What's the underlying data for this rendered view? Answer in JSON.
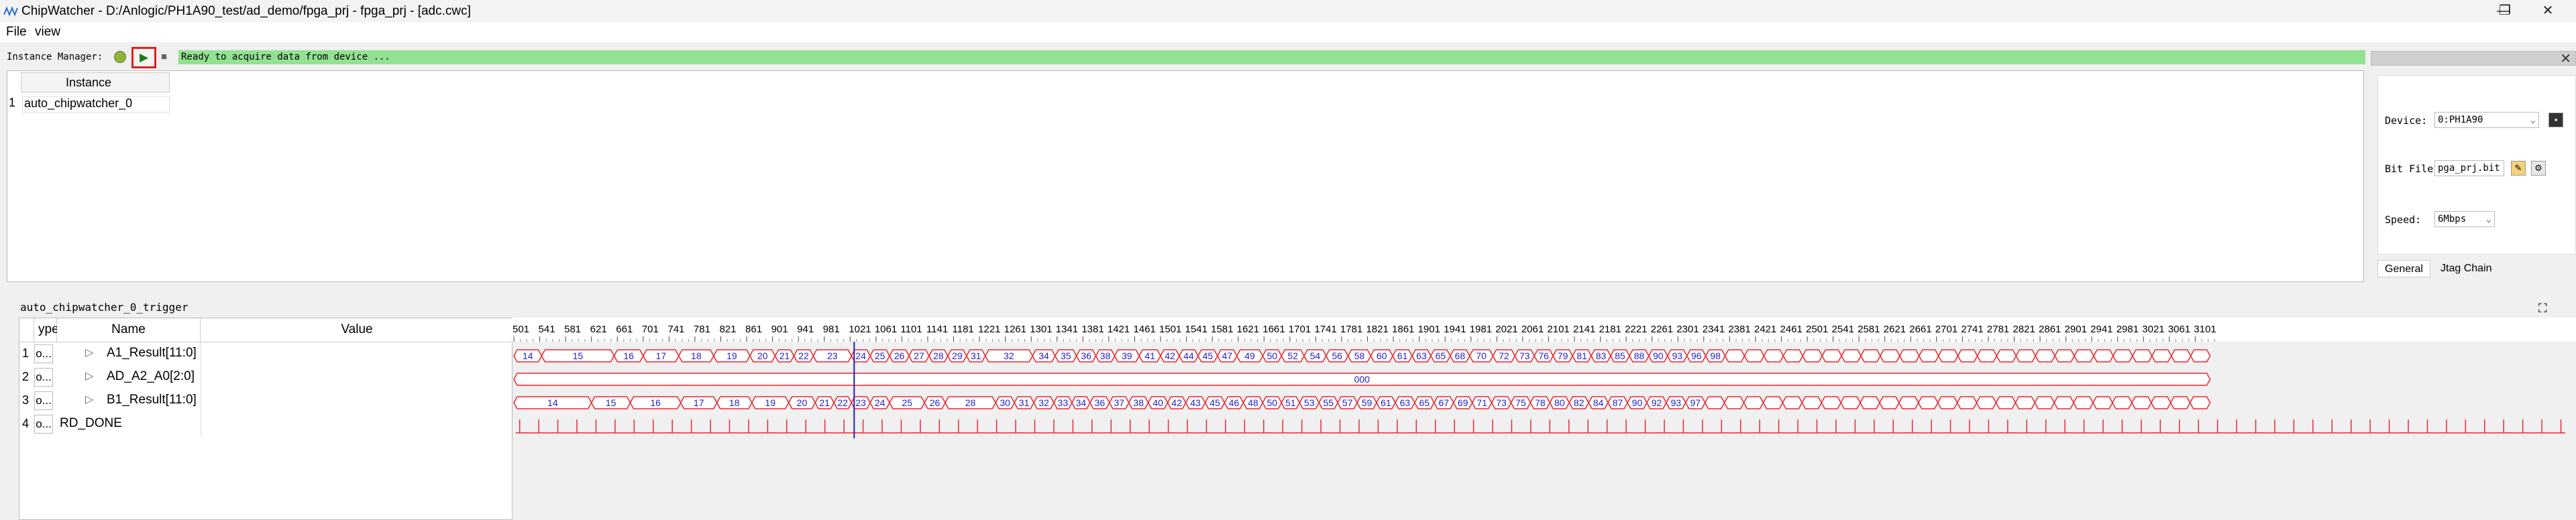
{
  "window": {
    "title": "ChipWatcher - D:/Anlogic/PH1A90_test/ad_demo/fpga_prj - fpga_prj - [adc.cwc]",
    "minimize": "—",
    "maximize": "❐",
    "close": "✕"
  },
  "menu": {
    "file": "File",
    "view": "view"
  },
  "toolbar": {
    "instance_manager_label": "Instance Manager:",
    "play_glyph": "▶",
    "stop_glyph": "■",
    "status_text": "Ready to acquire data from device ..."
  },
  "instances": {
    "header": "Instance",
    "rows": [
      {
        "num": "1",
        "name": "auto_chipwatcher_0"
      }
    ]
  },
  "jtag_panel": {
    "close": "✕",
    "device_label": "Device:",
    "device_value": "0:PH1A90",
    "bitfile_label": "Bit File:",
    "bitfile_value": "pga_prj.bit",
    "speed_label": "Speed:",
    "speed_value": "6Mbps",
    "tabs": [
      "General",
      "Jtag Chain"
    ]
  },
  "trigger": {
    "title": "auto_chipwatcher_0_trigger",
    "columns": {
      "type": "ype",
      "name": "Name",
      "value": "Value"
    },
    "signals": [
      {
        "num": "1",
        "type": "o...",
        "expand": "▷",
        "name": "A1_Result[11:0]"
      },
      {
        "num": "2",
        "type": "o...",
        "expand": "▷",
        "name": "AD_A2_A0[2:0]"
      },
      {
        "num": "3",
        "type": "o...",
        "expand": "▷",
        "name": "B1_Result[11:0]"
      },
      {
        "num": "4",
        "type": "o...",
        "expand": "",
        "name": "RD_DONE"
      }
    ]
  },
  "colors": {
    "wave": "#e8282e",
    "wave_text": "#2222cc",
    "cursor": "#2020c0",
    "status_bg": "#92e292"
  },
  "chart_data": {
    "type": "waveform",
    "ticks": [
      "501",
      "541",
      "581",
      "621",
      "661",
      "701",
      "741",
      "781",
      "821",
      "861",
      "901",
      "941",
      "981",
      "1021",
      "1061",
      "1101",
      "1141",
      "1181",
      "1221",
      "1261",
      "1301",
      "1341",
      "1381",
      "1421",
      "1461",
      "1501",
      "1541",
      "1581",
      "1621",
      "1661",
      "1701",
      "1741",
      "1781",
      "1821",
      "1861",
      "1901",
      "1941",
      "1981",
      "2021",
      "2061",
      "2101",
      "2141",
      "2181",
      "2221",
      "2261",
      "2301",
      "2341",
      "2381",
      "2421",
      "2461",
      "2501",
      "2541",
      "2581",
      "2621",
      "2661",
      "2701",
      "2741",
      "2781",
      "2821",
      "2861",
      "2901",
      "2941",
      "2981",
      "3021",
      "3061",
      "3101"
    ],
    "cursor_at": 1021,
    "buses": [
      {
        "name": "A1_Result[11:0]",
        "segments": [
          [
            501,
            544,
            "14"
          ],
          [
            544,
            656,
            "15"
          ],
          [
            656,
            701,
            "16"
          ],
          [
            701,
            756,
            "17"
          ],
          [
            756,
            810,
            "18"
          ],
          [
            810,
            866,
            "19"
          ],
          [
            866,
            905,
            "20"
          ],
          [
            905,
            934,
            "21"
          ],
          [
            934,
            964,
            "22"
          ],
          [
            964,
            1023,
            "23"
          ],
          [
            1023,
            1052,
            "24"
          ],
          [
            1052,
            1082,
            "25"
          ],
          [
            1082,
            1112,
            "26"
          ],
          [
            1112,
            1143,
            "27"
          ],
          [
            1143,
            1172,
            "28"
          ],
          [
            1172,
            1201,
            "29"
          ],
          [
            1201,
            1230,
            "31"
          ],
          [
            1230,
            1303,
            "32"
          ],
          [
            1303,
            1338,
            "34"
          ],
          [
            1338,
            1371,
            "35"
          ],
          [
            1371,
            1401,
            "36"
          ],
          [
            1401,
            1430,
            "38"
          ],
          [
            1430,
            1468,
            "39"
          ],
          [
            1468,
            1501,
            "41"
          ],
          [
            1501,
            1530,
            "42"
          ],
          [
            1530,
            1559,
            "44"
          ],
          [
            1559,
            1589,
            "45"
          ],
          [
            1589,
            1619,
            "47"
          ],
          [
            1619,
            1659,
            "49"
          ],
          [
            1659,
            1688,
            "50"
          ],
          [
            1688,
            1723,
            "52"
          ],
          [
            1723,
            1757,
            "54"
          ],
          [
            1757,
            1791,
            "56"
          ],
          [
            1791,
            1826,
            "58"
          ],
          [
            1826,
            1860,
            "60"
          ],
          [
            1860,
            1890,
            "61"
          ],
          [
            1890,
            1919,
            "63"
          ],
          [
            1919,
            1949,
            "65"
          ],
          [
            1949,
            1979,
            "68"
          ],
          [
            1979,
            2015,
            "70"
          ],
          [
            2015,
            2049,
            "72"
          ],
          [
            2049,
            2079,
            "73"
          ],
          [
            2079,
            2108,
            "76"
          ],
          [
            2108,
            2138,
            "79"
          ],
          [
            2138,
            2167,
            "81"
          ],
          [
            2167,
            2197,
            "83"
          ],
          [
            2197,
            2226,
            "85"
          ],
          [
            2226,
            2256,
            "88"
          ],
          [
            2256,
            2285,
            "90"
          ],
          [
            2285,
            2315,
            "93"
          ],
          [
            2315,
            2344,
            "96"
          ],
          [
            2344,
            2374,
            "98"
          ],
          [
            2374,
            2404,
            ""
          ],
          [
            2404,
            2434,
            ""
          ],
          [
            2434,
            2464,
            ""
          ],
          [
            2464,
            2494,
            ""
          ],
          [
            2494,
            2524,
            ""
          ],
          [
            2524,
            2554,
            ""
          ],
          [
            2554,
            2584,
            ""
          ],
          [
            2584,
            2614,
            ""
          ],
          [
            2614,
            2644,
            ""
          ],
          [
            2644,
            2674,
            ""
          ],
          [
            2674,
            2704,
            ""
          ],
          [
            2704,
            2734,
            ""
          ],
          [
            2734,
            2764,
            ""
          ],
          [
            2764,
            2794,
            ""
          ],
          [
            2794,
            2824,
            ""
          ],
          [
            2824,
            2854,
            ""
          ],
          [
            2854,
            2884,
            ""
          ],
          [
            2884,
            2914,
            ""
          ],
          [
            2914,
            2944,
            ""
          ],
          [
            2944,
            2974,
            ""
          ],
          [
            2974,
            3004,
            ""
          ],
          [
            3004,
            3034,
            ""
          ],
          [
            3034,
            3064,
            ""
          ],
          [
            3064,
            3094,
            ""
          ],
          [
            3094,
            3124,
            ""
          ]
        ]
      },
      {
        "name": "AD_A2_A0[2:0]",
        "segments": [
          [
            501,
            3124,
            "000"
          ]
        ]
      },
      {
        "name": "B1_Result[11:0]",
        "segments": [
          [
            501,
            621,
            "14"
          ],
          [
            621,
            681,
            "15"
          ],
          [
            681,
            759,
            "16"
          ],
          [
            759,
            815,
            "17"
          ],
          [
            815,
            869,
            "18"
          ],
          [
            869,
            926,
            "19"
          ],
          [
            926,
            967,
            "20"
          ],
          [
            967,
            996,
            "21"
          ],
          [
            996,
            1023,
            "22"
          ],
          [
            1023,
            1052,
            "23"
          ],
          [
            1052,
            1082,
            "24"
          ],
          [
            1082,
            1136,
            "25"
          ],
          [
            1136,
            1168,
            "26"
          ],
          [
            1168,
            1246,
            "28"
          ],
          [
            1246,
            1275,
            "30"
          ],
          [
            1275,
            1305,
            "31"
          ],
          [
            1305,
            1336,
            "32"
          ],
          [
            1336,
            1364,
            "33"
          ],
          [
            1364,
            1392,
            "34"
          ],
          [
            1392,
            1422,
            "36"
          ],
          [
            1422,
            1452,
            "37"
          ],
          [
            1452,
            1482,
            "38"
          ],
          [
            1482,
            1512,
            "40"
          ],
          [
            1512,
            1540,
            "42"
          ],
          [
            1540,
            1570,
            "43"
          ],
          [
            1570,
            1600,
            "45"
          ],
          [
            1600,
            1629,
            "46"
          ],
          [
            1629,
            1659,
            "48"
          ],
          [
            1659,
            1688,
            "50"
          ],
          [
            1688,
            1716,
            "51"
          ],
          [
            1716,
            1746,
            "53"
          ],
          [
            1746,
            1775,
            "55"
          ],
          [
            1775,
            1805,
            "57"
          ],
          [
            1805,
            1835,
            "59"
          ],
          [
            1835,
            1864,
            "61"
          ],
          [
            1864,
            1894,
            "63"
          ],
          [
            1894,
            1924,
            "65"
          ],
          [
            1924,
            1954,
            "67"
          ],
          [
            1954,
            1983,
            "69"
          ],
          [
            1983,
            2013,
            "71"
          ],
          [
            2013,
            2043,
            "73"
          ],
          [
            2043,
            2073,
            "75"
          ],
          [
            2073,
            2103,
            "78"
          ],
          [
            2103,
            2133,
            "80"
          ],
          [
            2133,
            2163,
            "82"
          ],
          [
            2163,
            2193,
            "84"
          ],
          [
            2193,
            2223,
            "87"
          ],
          [
            2223,
            2253,
            "90"
          ],
          [
            2253,
            2283,
            "92"
          ],
          [
            2283,
            2313,
            "93"
          ],
          [
            2313,
            2343,
            "97"
          ],
          [
            2343,
            2373,
            ""
          ],
          [
            2373,
            2403,
            ""
          ],
          [
            2403,
            2433,
            ""
          ],
          [
            2433,
            2463,
            ""
          ],
          [
            2463,
            2493,
            ""
          ],
          [
            2493,
            2523,
            ""
          ],
          [
            2523,
            2553,
            ""
          ],
          [
            2553,
            2583,
            ""
          ],
          [
            2583,
            2613,
            ""
          ],
          [
            2613,
            2643,
            ""
          ],
          [
            2643,
            2673,
            ""
          ],
          [
            2673,
            2703,
            ""
          ],
          [
            2703,
            2733,
            ""
          ],
          [
            2733,
            2763,
            ""
          ],
          [
            2763,
            2793,
            ""
          ],
          [
            2793,
            2823,
            ""
          ],
          [
            2823,
            2853,
            ""
          ],
          [
            2853,
            2883,
            ""
          ],
          [
            2883,
            2913,
            ""
          ],
          [
            2913,
            2943,
            ""
          ],
          [
            2943,
            2973,
            ""
          ],
          [
            2973,
            3003,
            ""
          ],
          [
            3003,
            3033,
            ""
          ],
          [
            3033,
            3063,
            ""
          ],
          [
            3063,
            3093,
            ""
          ],
          [
            3093,
            3124,
            ""
          ]
        ]
      }
    ],
    "pulses": {
      "name": "RD_DONE",
      "start": 510,
      "period": 29.5,
      "end": 3124
    }
  }
}
